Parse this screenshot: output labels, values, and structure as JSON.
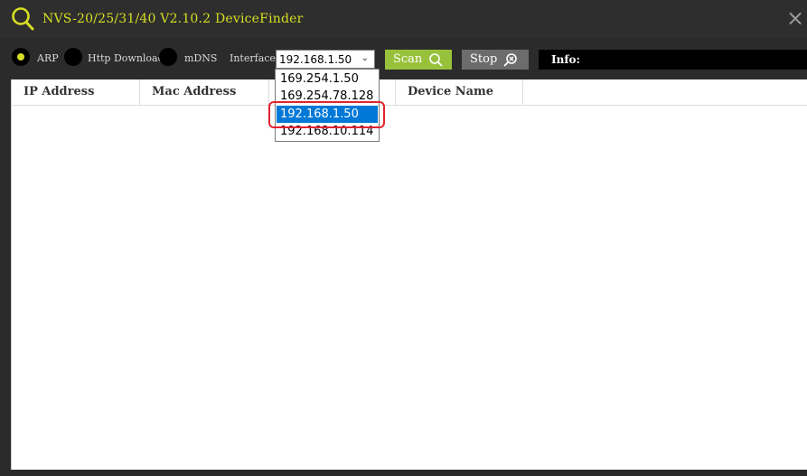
{
  "window": {
    "title": "NVS-20/25/31/40 V2.10.2 DeviceFinder",
    "close_glyph": "×"
  },
  "toolbar": {
    "modes": [
      {
        "label": "ARP",
        "selected": true
      },
      {
        "label": "Http Download",
        "selected": false
      },
      {
        "label": "mDNS",
        "selected": false
      }
    ],
    "interface_label": "Interface:",
    "interface_value": "192.168.1.50",
    "scan_label": "Scan",
    "stop_label": "Stop",
    "info_label": "Info:"
  },
  "dropdown": {
    "options": [
      "169.254.1.50",
      "169.254.78.128",
      "192.168.1.50",
      "192.168.10.114"
    ],
    "selected_index": 2
  },
  "table": {
    "columns": [
      "IP Address",
      "Mac Address",
      "",
      "Device Name",
      ""
    ],
    "rows": []
  },
  "colors": {
    "accent": "#d7df23",
    "scan": "#98c13b",
    "stop": "#6c6c6c",
    "selection": "#0078d7",
    "highlight": "#e0242f"
  },
  "icons": [
    "search-icon",
    "close-icon",
    "scan-search-icon",
    "stop-search-icon",
    "chevron-down-icon"
  ]
}
